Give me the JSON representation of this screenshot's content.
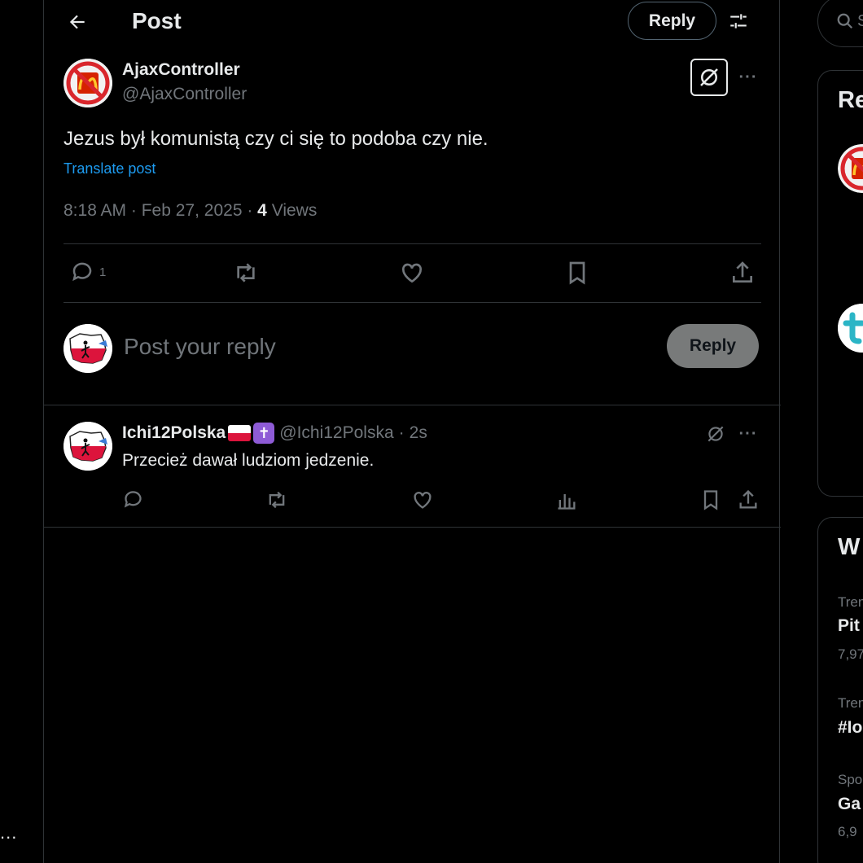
{
  "header": {
    "title": "Post",
    "reply_label": "Reply",
    "back_icon": "arrow-left-icon",
    "filter_icon": "sliders-icon"
  },
  "main_post": {
    "display_name": "AjaxController",
    "handle": "@AjaxController",
    "text": "Jezus był komunistą czy ci się to podoba czy nie.",
    "translate_label": "Translate post",
    "time": "8:18 AM",
    "date": "Feb 27, 2025",
    "views_count": "4",
    "views_label": "Views",
    "actions": {
      "reply_count": "1"
    }
  },
  "composer": {
    "placeholder": "Post your reply",
    "reply_label": "Reply"
  },
  "reply_post": {
    "display_name": "Ichi12Polska",
    "handle": "@Ichi12Polska",
    "time": "2s",
    "text": "Przecież dawał ludziom jedzenie."
  },
  "right": {
    "search_partial": "S",
    "card1_heading": "Re",
    "card2_heading": "W",
    "trends": [
      {
        "meta": "Tren",
        "title": "Pit",
        "count": "7,97"
      },
      {
        "meta": "Tren",
        "title": "#Io"
      },
      {
        "meta": "Spo",
        "title": "Ga",
        "count": "6,9"
      }
    ]
  },
  "left_more": "..."
}
